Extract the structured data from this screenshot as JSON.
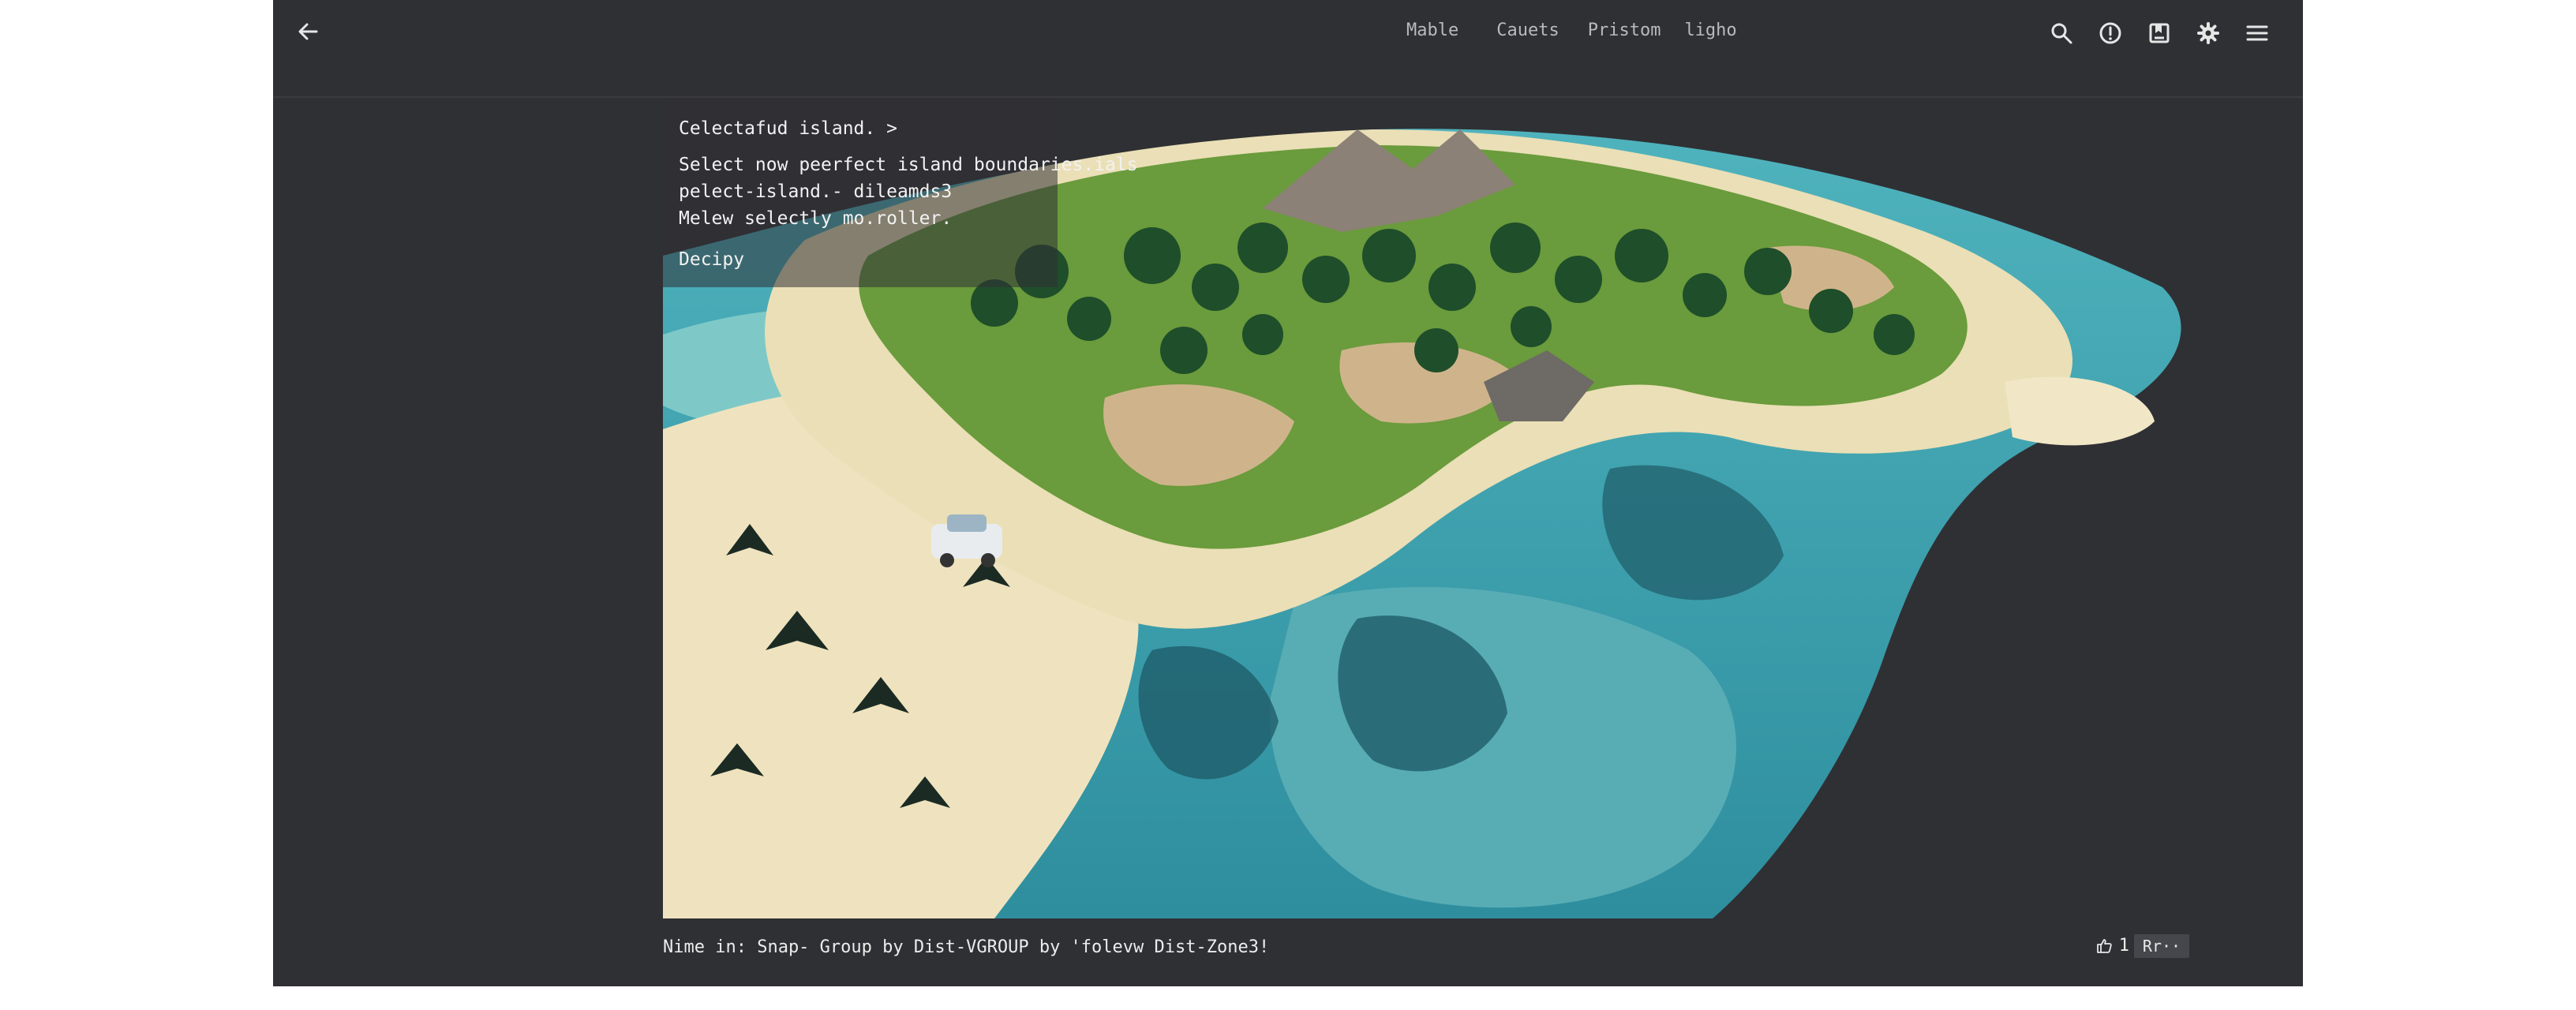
{
  "nav": {
    "tabs": [
      "Mable",
      "Cauets",
      "Pristom",
      "ligho"
    ]
  },
  "toolbar": {
    "icons": [
      "search-icon",
      "info-icon",
      "bookmark-icon",
      "gear-icon",
      "menu-icon"
    ]
  },
  "overlay": {
    "heading": "Celectafud island. >",
    "line1": "Select now peerfect island boundaries.ials",
    "line2": "pelect-island.- dileamds3",
    "line3": "Melew selectly mo.roller.",
    "line4": "Decipy"
  },
  "footer": {
    "caption": "Nime in: Snap- Group by Dist-VGROUP by 'folevw Dist-Zone3!",
    "likes": "1",
    "action_label": "Rr··"
  },
  "colors": {
    "background": "#2f3034",
    "water": "#3fa6b4",
    "sand": "#efe3bf",
    "grass": "#6a9b3c"
  }
}
